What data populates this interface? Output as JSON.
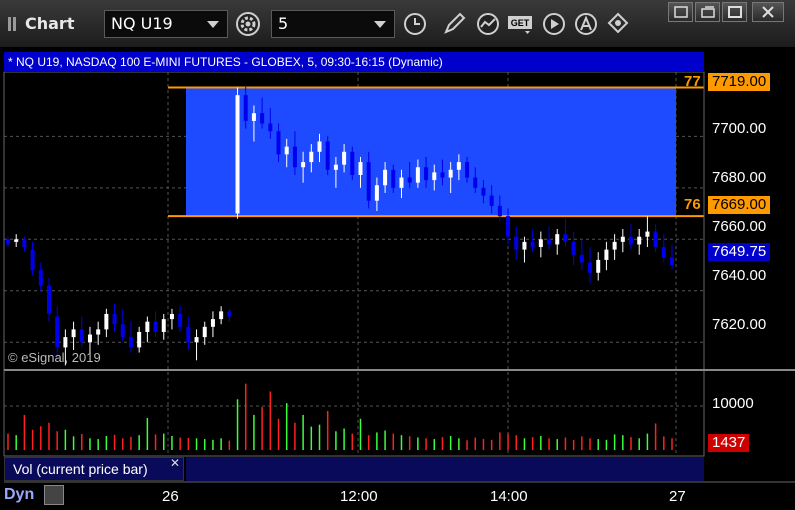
{
  "app": {
    "title": "Chart"
  },
  "toolbar": {
    "symbol": "NQ U19",
    "interval": "5",
    "icons": [
      "settings-icon",
      "clock-icon",
      "pencil-icon",
      "study-icon",
      "get-icon",
      "play-icon",
      "alert-icon",
      "pin-icon"
    ]
  },
  "window_buttons": [
    "restore-icon",
    "popout-icon",
    "maximize-icon",
    "close-icon"
  ],
  "chart": {
    "info": "* NQ U19, NASDAQ 100 E-MINI FUTURES - GLOBEX, 5, 09:30-16:15 (Dynamic)",
    "copyright": "© eSignal, 2019",
    "price_axis": [
      "7700.00",
      "7680.00",
      "7660.00",
      "7640.00",
      "7620.00"
    ],
    "level_top": {
      "label": "77",
      "price": "7719.00"
    },
    "level_bottom": {
      "label": "76",
      "price": "7669.00"
    },
    "last_price": "7649.75",
    "time_axis": [
      "26",
      "12:00",
      "14:00",
      "27"
    ],
    "colors": {
      "box": "#1e4bff",
      "level_line": "#ff9900",
      "up": "#ffffff",
      "down": "#0000ee",
      "last_price_bg": "#0000cc"
    }
  },
  "volume": {
    "label": "Vol (current price bar)",
    "axis": [
      "10000"
    ],
    "last": "1437",
    "colors": {
      "up": "#3aff3a",
      "down": "#ff2020",
      "last_bg": "#cc0000"
    }
  },
  "status": {
    "mode": "Dyn"
  },
  "chart_data": {
    "type": "candlestick",
    "ylim": [
      7610,
      7725
    ],
    "candles": [
      [
        7660,
        7661,
        7657,
        7658
      ],
      [
        7659,
        7662,
        7657,
        7660
      ],
      [
        7660,
        7661,
        7655,
        7657
      ],
      [
        7656,
        7659,
        7646,
        7648
      ],
      [
        7648,
        7651,
        7640,
        7642
      ],
      [
        7642,
        7645,
        7628,
        7631
      ],
      [
        7630,
        7634,
        7614,
        7618
      ],
      [
        7618,
        7625,
        7611,
        7622
      ],
      [
        7622,
        7628,
        7617,
        7625
      ],
      [
        7625,
        7630,
        7618,
        7620
      ],
      [
        7620,
        7626,
        7615,
        7623
      ],
      [
        7623,
        7628,
        7619,
        7625
      ],
      [
        7625,
        7633,
        7622,
        7631
      ],
      [
        7631,
        7635,
        7624,
        7627
      ],
      [
        7627,
        7633,
        7620,
        7622
      ],
      [
        7622,
        7628,
        7616,
        7618
      ],
      [
        7618,
        7626,
        7616,
        7624
      ],
      [
        7624,
        7630,
        7620,
        7628
      ],
      [
        7628,
        7632,
        7622,
        7624
      ],
      [
        7624,
        7631,
        7621,
        7629
      ],
      [
        7629,
        7633,
        7625,
        7631
      ],
      [
        7631,
        7634,
        7624,
        7626
      ],
      [
        7626,
        7630,
        7617,
        7620
      ],
      [
        7620,
        7625,
        7613,
        7622
      ],
      [
        7622,
        7628,
        7619,
        7626
      ],
      [
        7626,
        7632,
        7622,
        7629
      ],
      [
        7629,
        7634,
        7627,
        7632
      ],
      [
        7632,
        7633,
        7628,
        7630
      ],
      [
        7670,
        7719,
        7668,
        7716
      ],
      [
        7716,
        7720,
        7703,
        7706
      ],
      [
        7706,
        7712,
        7698,
        7709
      ],
      [
        7709,
        7715,
        7703,
        7705
      ],
      [
        7705,
        7711,
        7699,
        7702
      ],
      [
        7702,
        7705,
        7690,
        7693
      ],
      [
        7693,
        7699,
        7688,
        7696
      ],
      [
        7696,
        7702,
        7685,
        7688
      ],
      [
        7688,
        7694,
        7682,
        7690
      ],
      [
        7690,
        7697,
        7686,
        7694
      ],
      [
        7694,
        7701,
        7690,
        7698
      ],
      [
        7698,
        7700,
        7685,
        7687
      ],
      [
        7687,
        7692,
        7680,
        7689
      ],
      [
        7689,
        7697,
        7686,
        7694
      ],
      [
        7694,
        7696,
        7683,
        7685
      ],
      [
        7685,
        7692,
        7680,
        7690
      ],
      [
        7690,
        7694,
        7672,
        7675
      ],
      [
        7675,
        7684,
        7671,
        7681
      ],
      [
        7681,
        7690,
        7678,
        7687
      ],
      [
        7687,
        7689,
        7678,
        7680
      ],
      [
        7680,
        7687,
        7676,
        7684
      ],
      [
        7684,
        7690,
        7680,
        7682
      ],
      [
        7682,
        7691,
        7680,
        7688
      ],
      [
        7688,
        7692,
        7680,
        7683
      ],
      [
        7683,
        7689,
        7679,
        7686
      ],
      [
        7686,
        7691,
        7681,
        7684
      ],
      [
        7684,
        7690,
        7678,
        7687
      ],
      [
        7687,
        7693,
        7683,
        7690
      ],
      [
        7690,
        7692,
        7682,
        7684
      ],
      [
        7684,
        7688,
        7678,
        7680
      ],
      [
        7680,
        7683,
        7674,
        7677
      ],
      [
        7677,
        7681,
        7670,
        7673
      ],
      [
        7673,
        7677,
        7667,
        7669
      ],
      [
        7669,
        7672,
        7658,
        7661
      ],
      [
        7661,
        7665,
        7652,
        7656
      ],
      [
        7656,
        7661,
        7651,
        7659
      ],
      [
        7659,
        7664,
        7655,
        7657
      ],
      [
        7657,
        7663,
        7653,
        7660
      ],
      [
        7660,
        7665,
        7656,
        7658
      ],
      [
        7658,
        7664,
        7654,
        7662
      ],
      [
        7662,
        7668,
        7657,
        7659
      ],
      [
        7659,
        7663,
        7650,
        7654
      ],
      [
        7654,
        7660,
        7648,
        7651
      ],
      [
        7651,
        7657,
        7643,
        7647
      ],
      [
        7647,
        7655,
        7644,
        7652
      ],
      [
        7652,
        7659,
        7648,
        7656
      ],
      [
        7656,
        7662,
        7652,
        7659
      ],
      [
        7659,
        7664,
        7655,
        7661
      ],
      [
        7661,
        7666,
        7656,
        7658
      ],
      [
        7658,
        7664,
        7654,
        7661
      ],
      [
        7661,
        7669,
        7657,
        7663
      ],
      [
        7663,
        7666,
        7655,
        7657
      ],
      [
        7657,
        7662,
        7651,
        7653
      ],
      [
        7653,
        7658,
        7648,
        7650
      ]
    ],
    "volume": [
      420,
      380,
      900,
      520,
      610,
      700,
      480,
      520,
      350,
      410,
      300,
      280,
      360,
      390,
      300,
      340,
      380,
      820,
      400,
      420,
      360,
      320,
      310,
      300,
      280,
      260,
      300,
      240,
      1300,
      1700,
      900,
      1100,
      1500,
      800,
      1200,
      700,
      900,
      600,
      650,
      1000,
      480,
      550,
      420,
      800,
      380,
      450,
      500,
      420,
      380,
      350,
      320,
      300,
      280,
      330,
      360,
      300,
      250,
      320,
      280,
      260,
      450,
      420,
      380,
      300,
      330,
      360,
      300,
      280,
      320,
      260,
      350,
      300,
      280,
      260,
      400,
      380,
      330,
      300,
      420,
      680,
      350,
      300
    ]
  }
}
